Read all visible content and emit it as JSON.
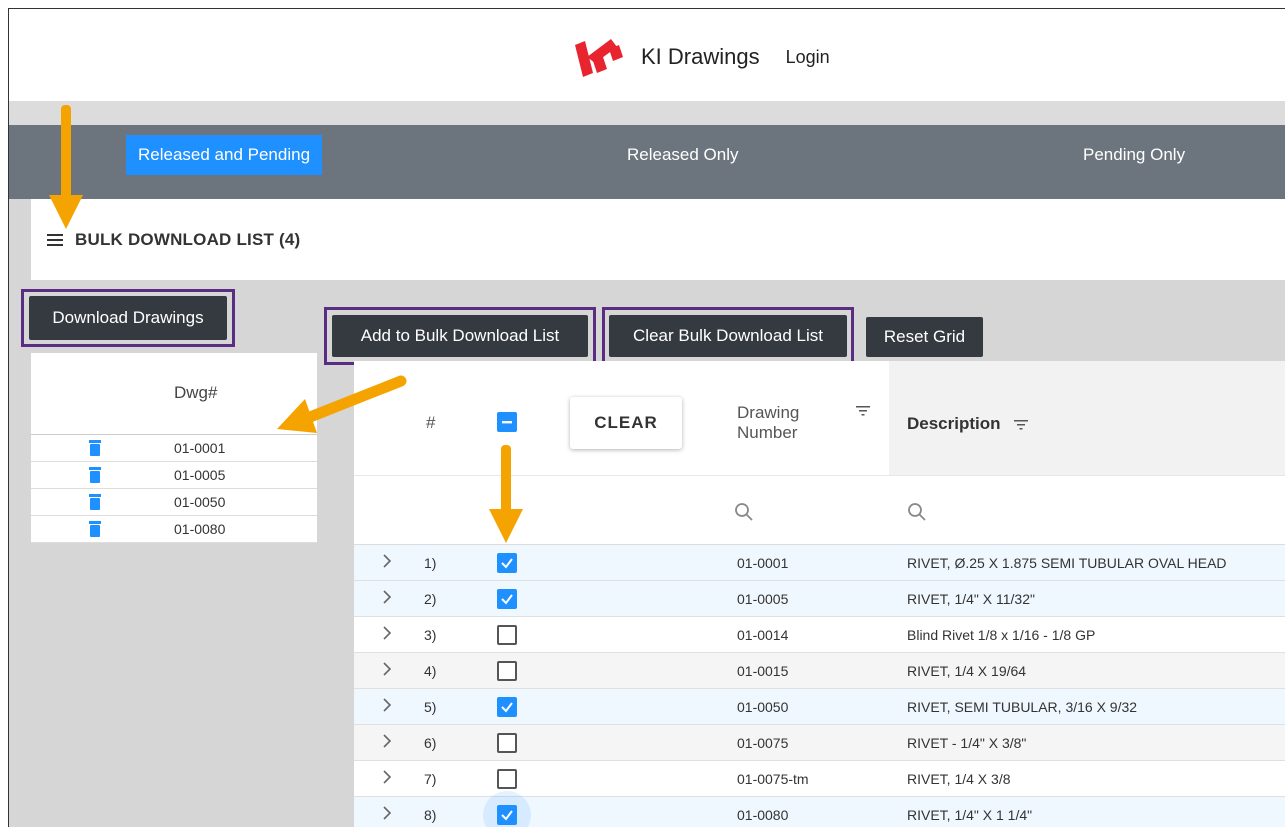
{
  "header": {
    "logo_text": "KI",
    "app_title": "KI Drawings",
    "login_label": "Login"
  },
  "nav": {
    "items": [
      {
        "label": "Released and Pending",
        "active": true
      },
      {
        "label": "Released Only",
        "active": false
      },
      {
        "label": "Pending Only",
        "active": false
      }
    ]
  },
  "bulk": {
    "title": "BULK DOWNLOAD LIST (4)",
    "download_label": "Download Drawings",
    "list_header": "Dwg#",
    "items": [
      "01-0001",
      "01-0005",
      "01-0050",
      "01-0080"
    ]
  },
  "toolbar": {
    "add_label": "Add to Bulk Download List",
    "clear_label": "Clear Bulk Download List",
    "reset_label": "Reset Grid"
  },
  "grid": {
    "col_num": "#",
    "clear_button": "CLEAR",
    "col_drawing_line1": "Drawing",
    "col_drawing_line2": "Number",
    "col_description": "Description",
    "rows": [
      {
        "num": "1)",
        "checked": true,
        "drawing": "01-0001",
        "description": "RIVET, Ø.25 X 1.875 SEMI TUBULAR OVAL HEAD"
      },
      {
        "num": "2)",
        "checked": true,
        "drawing": "01-0005",
        "description": "RIVET, 1/4\" X 11/32\""
      },
      {
        "num": "3)",
        "checked": false,
        "drawing": "01-0014",
        "description": "Blind Rivet 1/8 x 1/16 - 1/8 GP"
      },
      {
        "num": "4)",
        "checked": false,
        "drawing": "01-0015",
        "description": "RIVET, 1/4 X 19/64"
      },
      {
        "num": "5)",
        "checked": true,
        "drawing": "01-0050",
        "description": "RIVET, SEMI TUBULAR, 3/16 X 9/32"
      },
      {
        "num": "6)",
        "checked": false,
        "drawing": "01-0075",
        "description": "RIVET - 1/4\" X 3/8\""
      },
      {
        "num": "7)",
        "checked": false,
        "drawing": "01-0075-tm",
        "description": "RIVET, 1/4 X 3/8"
      },
      {
        "num": "8)",
        "checked": true,
        "drawing": "01-0080",
        "description": "RIVET, 1/4\" X 1 1/4\""
      }
    ]
  },
  "colors": {
    "accent": "#1e90ff",
    "navbar": "#6c757d",
    "button_dark": "#343a40",
    "highlight_box": "#5a2d82",
    "annotation_arrow": "#f5a300",
    "logo_red": "#e8242e"
  }
}
